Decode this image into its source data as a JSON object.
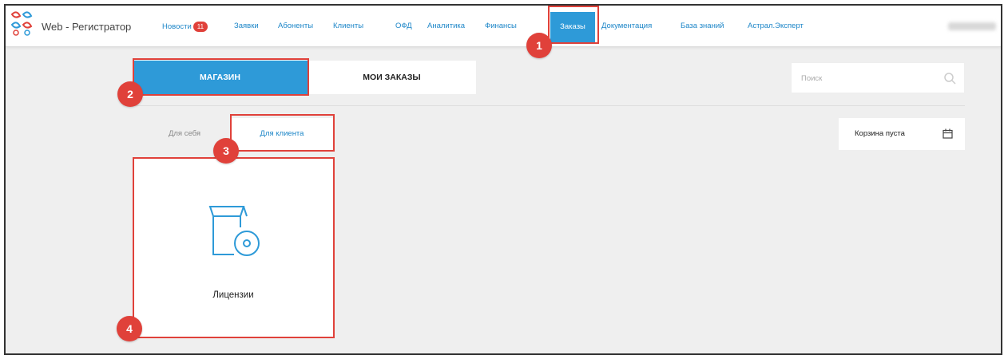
{
  "app": {
    "title": "Web - Регистратор"
  },
  "nav": {
    "items": [
      {
        "label": "Новости",
        "badge": "11"
      },
      {
        "label": "Заявки"
      },
      {
        "label": "Абоненты"
      },
      {
        "label": "Клиенты"
      },
      {
        "label": "ОФД"
      },
      {
        "label": "Аналитика"
      },
      {
        "label": "Финансы"
      },
      {
        "label": "Заказы",
        "active": true
      },
      {
        "label": "Документация"
      },
      {
        "label": "База знаний"
      },
      {
        "label": "Астрал.Эксперт"
      }
    ]
  },
  "main_tabs": [
    {
      "label": "МАГАЗИН",
      "active": true
    },
    {
      "label": "МОИ ЗАКАЗЫ"
    }
  ],
  "search": {
    "placeholder": "Поиск"
  },
  "sub_tabs": [
    {
      "label": "Для себя"
    },
    {
      "label": "Для клиента",
      "active": true
    }
  ],
  "cart": {
    "label": "Корзина пуста"
  },
  "products": [
    {
      "label": "Лицензии",
      "icon": "license-box-icon"
    }
  ],
  "markers": [
    "1",
    "2",
    "3",
    "4"
  ],
  "colors": {
    "accent": "#2e9ad8",
    "link": "#1d86c8",
    "highlight": "#e0413a",
    "background": "#efefef"
  }
}
